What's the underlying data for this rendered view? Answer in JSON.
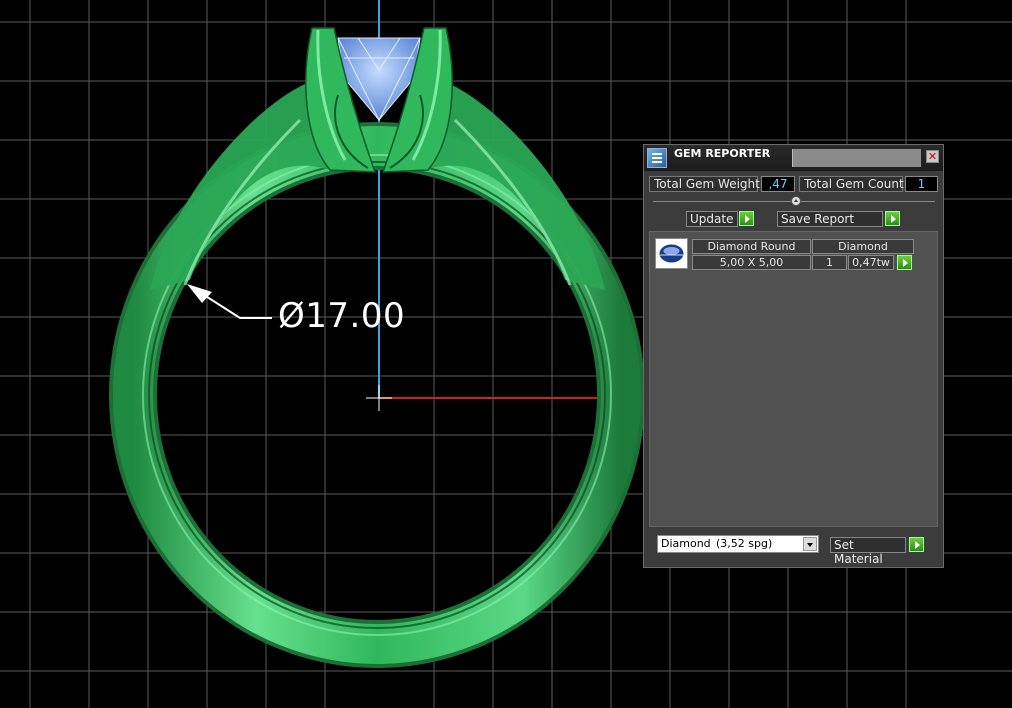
{
  "viewport": {
    "dimension_label": "Ø17.00",
    "colors": {
      "metal": "#3cc36a",
      "gem": "#8ab8f5",
      "grid": "#5a5a5a",
      "background": "#000000",
      "axis_x": "#cc2222",
      "axis_y": "#3aa8d8"
    }
  },
  "gem_reporter": {
    "title": "GEM REPORTER",
    "close_icon": "close-icon",
    "total_gem_weight_label": "Total Gem Weight",
    "total_gem_weight_value": ",47",
    "total_gem_count_label": "Total Gem Count",
    "total_gem_count_value": "1",
    "update_label": "Update",
    "save_report_label": "Save Report",
    "gem_list": {
      "header_shape": "Diamond Round",
      "header_material": "Diamond",
      "rows": [
        {
          "size": "5,00 X 5,00",
          "count": "1",
          "weight": "0,47tw"
        }
      ]
    },
    "material_select": {
      "name": "Diamond",
      "spg": "(3,52 spg)"
    },
    "set_material_label": "Set Material",
    "accent_color": "#4caf2a"
  }
}
